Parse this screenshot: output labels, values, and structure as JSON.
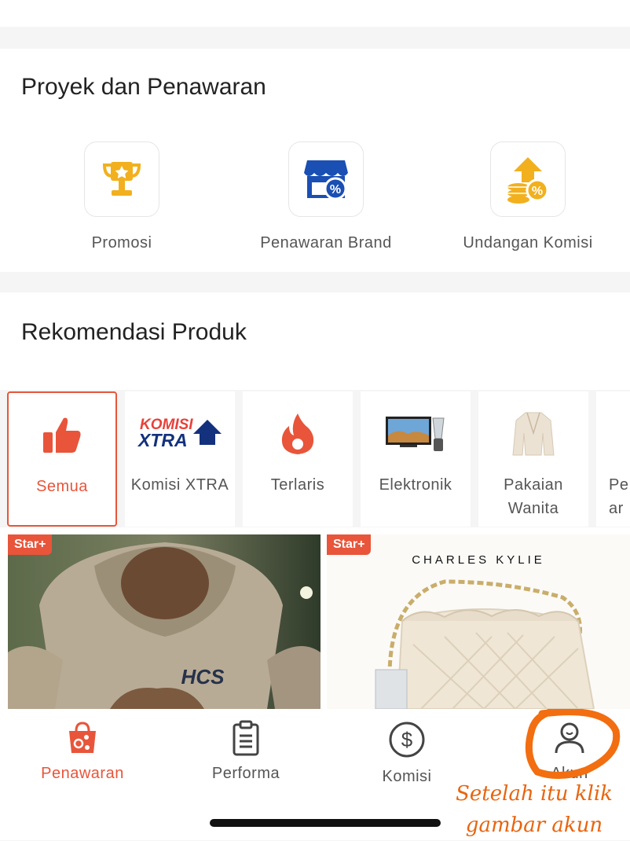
{
  "projects": {
    "title": "Proyek dan Penawaran",
    "items": [
      {
        "label": "Promosi",
        "icon": "trophy-icon"
      },
      {
        "label": "Penawaran Brand",
        "icon": "store-discount-icon"
      },
      {
        "label": "Undangan Komisi",
        "icon": "coins-up-icon"
      }
    ]
  },
  "recommend": {
    "title": "Rekomendasi Produk",
    "categories": [
      {
        "label": "Semua",
        "icon": "thumbs-up-icon",
        "active": true
      },
      {
        "label": "Komisi XTRA",
        "icon": "komisi-xtra-logo"
      },
      {
        "label": "Terlaris",
        "icon": "fire-icon"
      },
      {
        "label": "Elektronik",
        "icon": "tv-blender-icon"
      },
      {
        "label": "Pakaian Wanita",
        "icon": "blazer-icon"
      },
      {
        "label": "Pe ar",
        "icon": "partial-icon"
      }
    ],
    "logo_text": {
      "line1": "KOMISI",
      "line2": "XTRA"
    },
    "products": [
      {
        "badge": "Star+",
        "image": "hooded-jacket-photo",
        "logo_text": "HCS"
      },
      {
        "badge": "Star+",
        "brand": "CHARLES KYLIE",
        "image": "quilted-bag-photo"
      }
    ]
  },
  "navbar": {
    "items": [
      {
        "label": "Penawaran",
        "icon": "shopping-bag-icon",
        "active": true
      },
      {
        "label": "Performa",
        "icon": "clipboard-icon"
      },
      {
        "label": "Komisi",
        "icon": "dollar-circle-icon"
      },
      {
        "label": "Akun",
        "icon": "user-icon"
      }
    ]
  },
  "annotation": {
    "line1": "Setelah itu klik",
    "line2": "gambar akun"
  },
  "colors": {
    "accent": "#e8553a",
    "annotation": "#e8650f",
    "icon_blue": "#1a4fb3",
    "icon_gold": "#f2b01e"
  }
}
